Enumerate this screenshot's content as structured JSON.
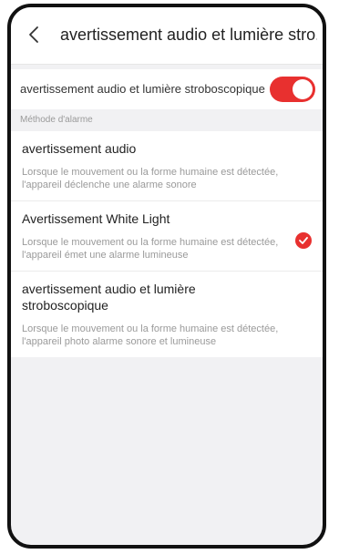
{
  "header": {
    "title": "avertissement audio et lumière stro..."
  },
  "toggle": {
    "label": "avertissement audio et lumière stroboscopique",
    "enabled": true,
    "accent": "#e8302f"
  },
  "section": {
    "title": "Méthode d'alarme"
  },
  "options": [
    {
      "title": "avertissement audio",
      "description": "Lorsque le mouvement ou la forme humaine est détectée, l'appareil déclenche une alarme sonore",
      "selected": false
    },
    {
      "title": "Avertissement White Light",
      "description": "Lorsque le mouvement ou la forme humaine est détectée, l'appareil émet une alarme lumineuse",
      "selected": true
    },
    {
      "title": "avertissement audio et lumière stroboscopique",
      "description": "Lorsque le mouvement ou la forme humaine est détectée, l'appareil photo alarme sonore et lumineuse",
      "selected": false
    }
  ],
  "icons": {
    "back": "chevron-left-icon",
    "check": "checkmark-icon"
  }
}
